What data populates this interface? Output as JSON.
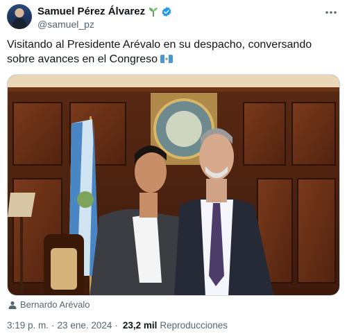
{
  "author": {
    "display_name": "Samuel Pérez Álvarez",
    "handle": "@samuel_pz",
    "avatar_icon": "profile-avatar",
    "badge_icon": "sprout-icon",
    "verified_icon": "verified-badge-icon",
    "verified_color": "#1d9bf0"
  },
  "menu": {
    "icon": "more-horizontal-icon"
  },
  "tweet": {
    "text": "Visitando al Presidente Arévalo en su despacho, conversando sobre avances en el Congreso",
    "emoji": "guatemala-flag-icon"
  },
  "media": {
    "type": "photo",
    "tagged_person": "Bernardo Arévalo",
    "tag_icon": "person-icon"
  },
  "meta": {
    "time": "3:19 p. m.",
    "separator": "·",
    "date": "23 ene. 2024",
    "views_count": "23,2 mil",
    "views_label": "Reproducciones"
  }
}
